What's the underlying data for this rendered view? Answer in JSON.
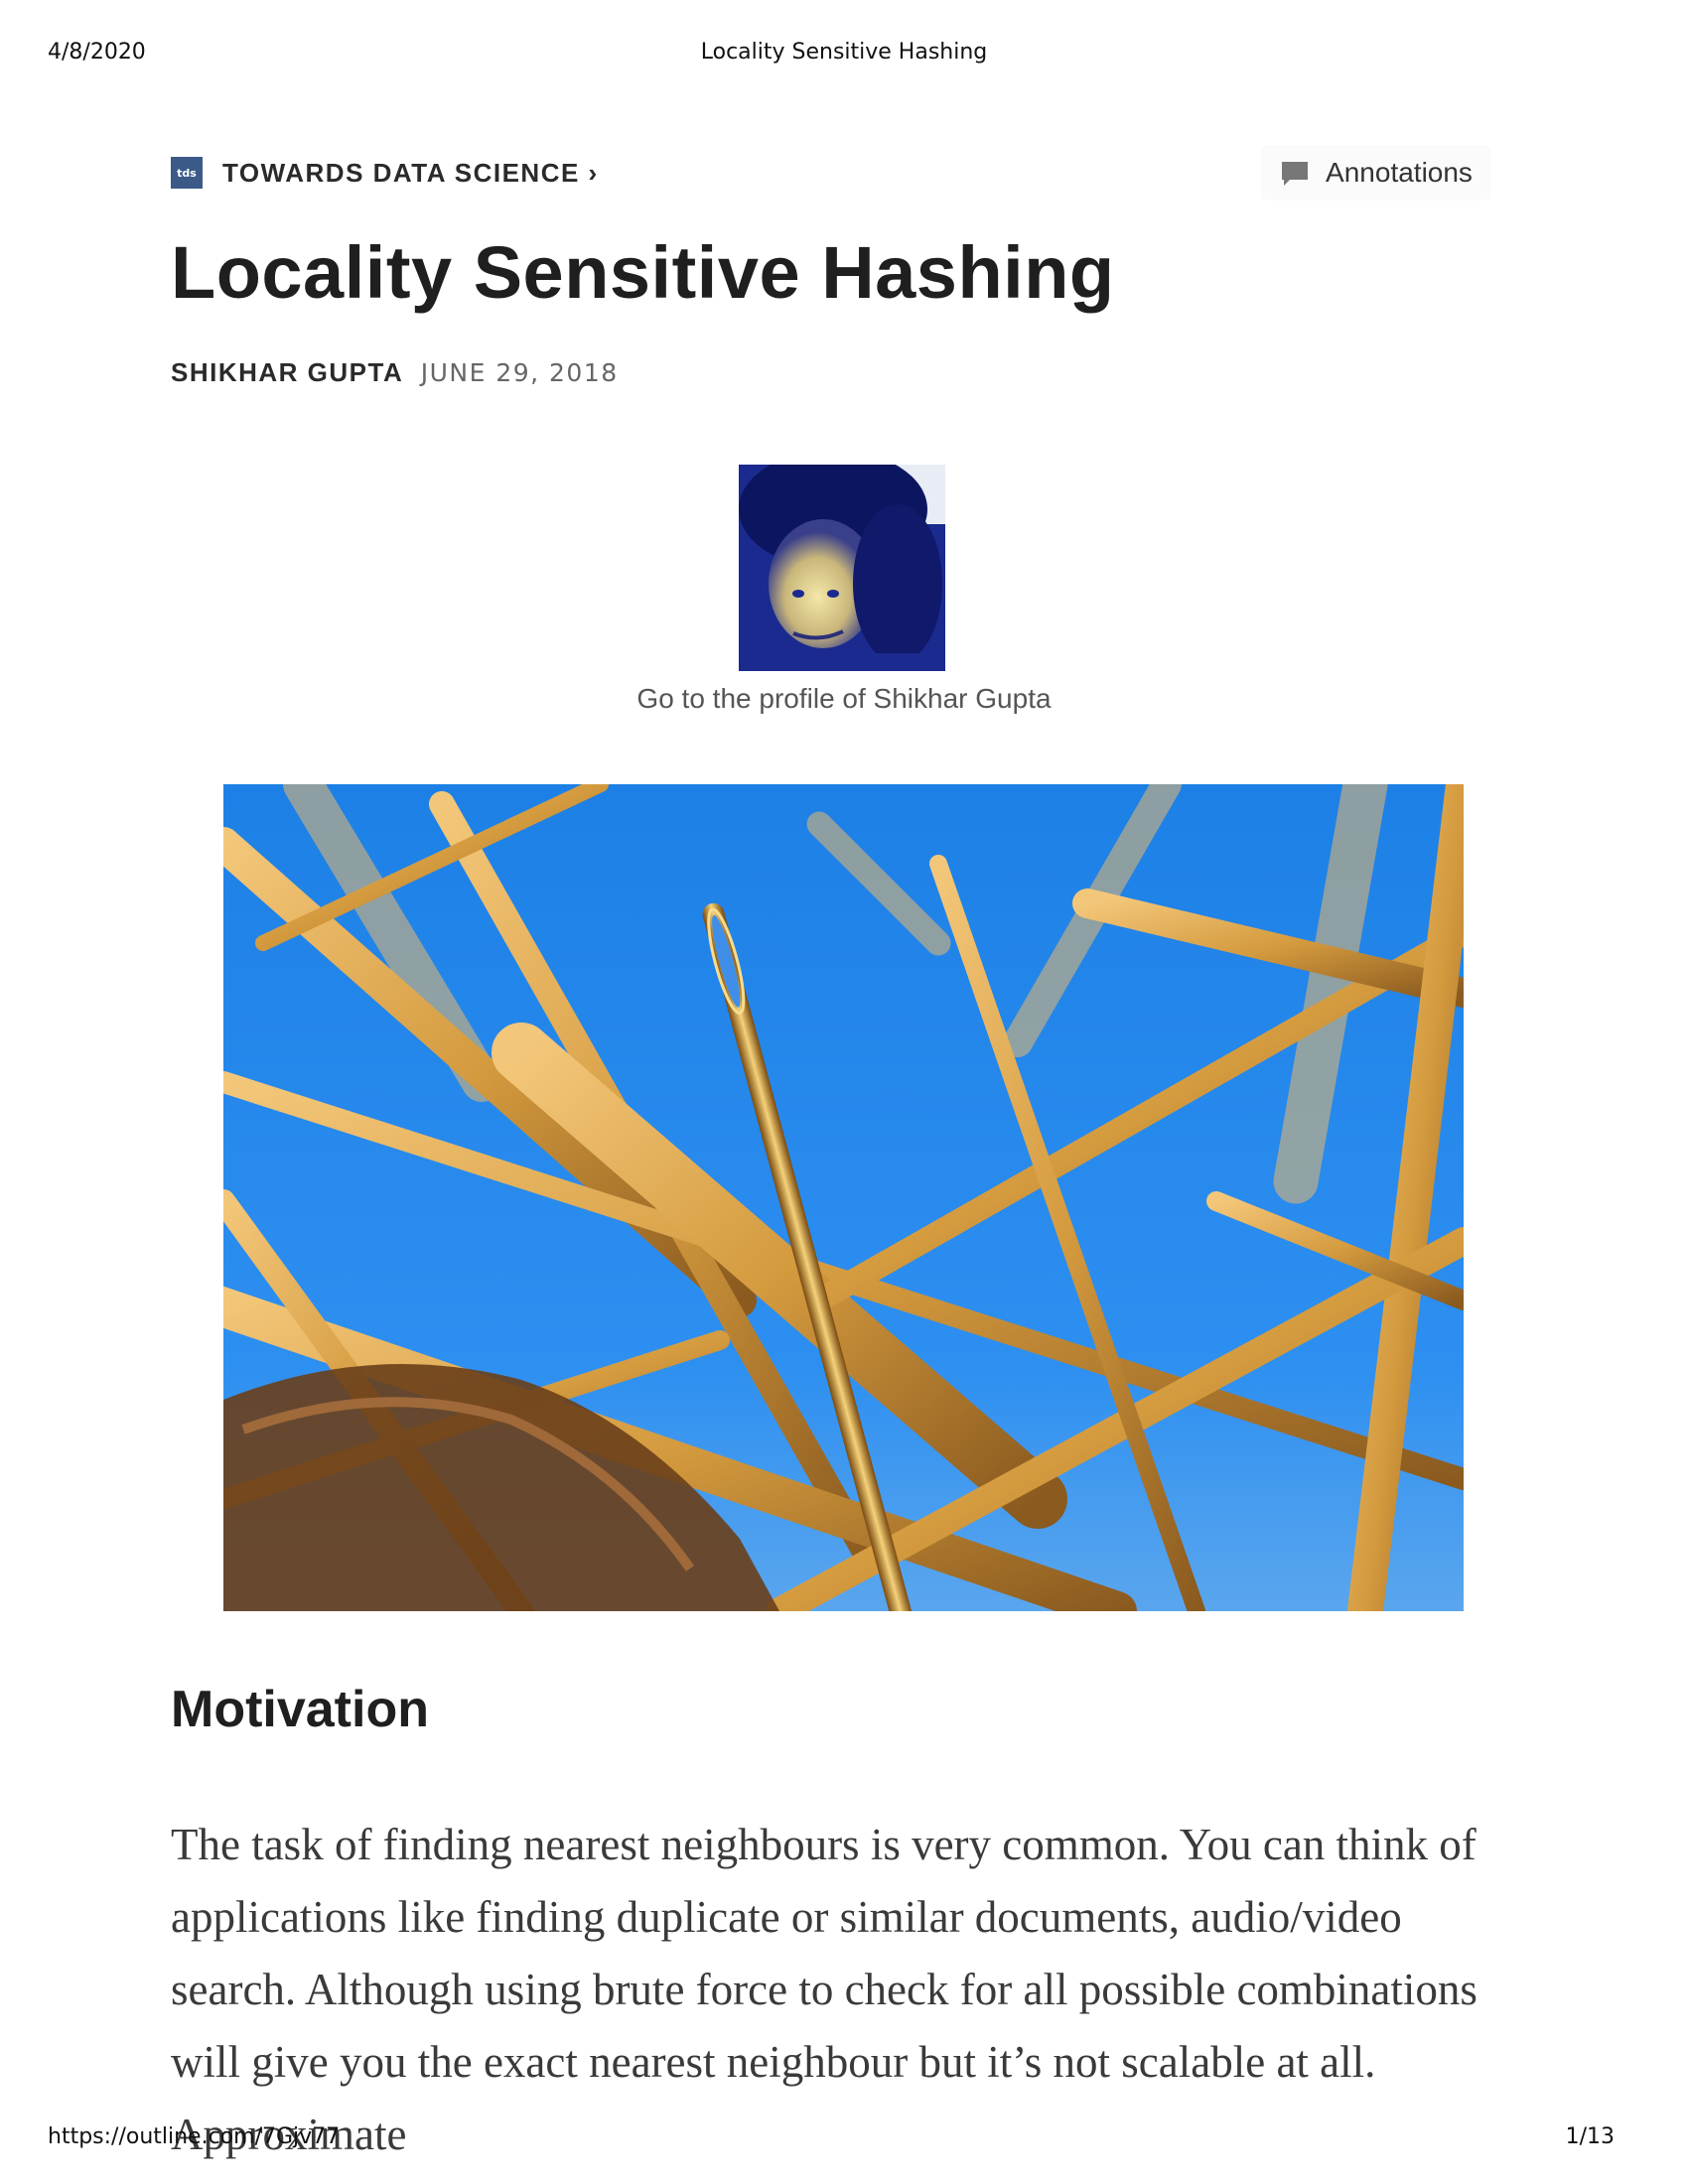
{
  "print": {
    "date": "4/8/2020",
    "title": "Locality Sensitive Hashing",
    "url": "https://outline.com/7Gjv77",
    "page": "1/13"
  },
  "publication": {
    "logo_text": "tds",
    "name": "TOWARDS DATA SCIENCE ›"
  },
  "annotations_label": "Annotations",
  "article": {
    "title": "Locality Sensitive Hashing",
    "author": "SHIKHAR GUPTA",
    "date": "JUNE 29, 2018",
    "avatar_caption": "Go to the profile of Shikhar Gupta",
    "section_heading": "Motivation",
    "paragraph": "The task of finding nearest neighbours is very common. You can think of applications like finding duplicate or similar documents, audio/video search. Although using brute force to check for all possible combinations will give you the exact nearest neighbour but it’s not scalable at all. Approximate"
  },
  "colors": {
    "logo_bg": "#3b5a87",
    "sky_blue": "#1a7fe0",
    "straw": "#d9a24a",
    "needle": "#c98a1e"
  }
}
